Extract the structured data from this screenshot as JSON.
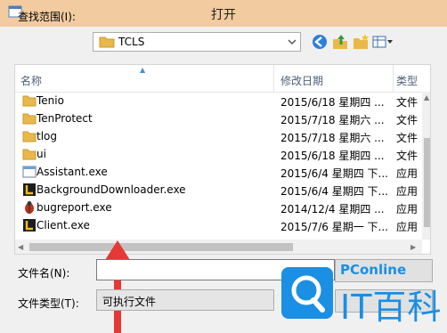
{
  "window": {
    "title": "打开"
  },
  "toolbar": {
    "lookin_label": "查找范围(I):",
    "current_folder": "TCLS"
  },
  "list": {
    "columns": [
      "名称",
      "修改日期",
      "类型"
    ],
    "rows": [
      {
        "name": "Tenio",
        "date": "2015/6/18 星期四 ...",
        "type": "文件",
        "icon": "folder-icon"
      },
      {
        "name": "TenProtect",
        "date": "2015/7/18 星期六 ...",
        "type": "文件",
        "icon": "folder-icon"
      },
      {
        "name": "tlog",
        "date": "2015/7/18 星期六 ...",
        "type": "文件",
        "icon": "folder-icon"
      },
      {
        "name": "ui",
        "date": "2015/6/18 星期四 ...",
        "type": "文件",
        "icon": "folder-icon"
      },
      {
        "name": "Assistant.exe",
        "date": "2015/6/4 星期四 下...",
        "type": "应用",
        "icon": "exe-icon"
      },
      {
        "name": "BackgroundDownloader.exe",
        "date": "2015/6/4 星期四 下...",
        "type": "应用",
        "icon": "app-l-icon"
      },
      {
        "name": "bugreport.exe",
        "date": "2014/12/4 星期四 ...",
        "type": "应用",
        "icon": "bug-icon"
      },
      {
        "name": "Client.exe",
        "date": "2015/7/6 星期一 下...",
        "type": "应用",
        "icon": "app-l-icon"
      }
    ]
  },
  "form": {
    "filename_label": "文件名(N):",
    "filename_value": "",
    "filetype_label": "文件类型(T):",
    "filetype_value": "可执行文件"
  },
  "watermark": {
    "brand_small": "PConline",
    "brand_large": "IT百科"
  },
  "colors": {
    "titlebar": "#f2cba0",
    "folder": "#e8b84a",
    "accent": "#1a8fe3",
    "arrow": "#e53935"
  }
}
